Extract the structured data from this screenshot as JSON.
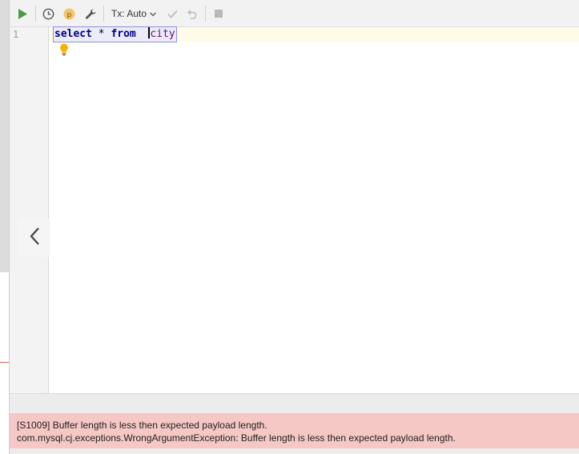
{
  "toolbar": {
    "run_icon": "play-icon",
    "history_icon": "clock-icon",
    "params_icon": "parameter-p-icon",
    "params_label": "p",
    "settings_icon": "wrench-icon",
    "tx_label": "Tx: Auto",
    "tx_dropdown_icon": "chevron-down-icon",
    "commit_icon": "check-icon",
    "rollback_icon": "undo-icon",
    "stop_icon": "stop-icon"
  },
  "editor": {
    "line_numbers": [
      "1"
    ],
    "code": {
      "kw1": "select",
      "mid": " * ",
      "kw2": "from",
      "space": "  ",
      "ident": "city"
    },
    "intention_icon": "lightbulb-icon"
  },
  "navigation": {
    "back_icon": "chevron-left-icon"
  },
  "error": {
    "line1": "[S1009] Buffer length is less then expected payload length.",
    "line2": "com.mysql.cj.exceptions.WrongArgumentException: Buffer length is less then expected payload length."
  },
  "colors": {
    "run_green": "#4a9c4a",
    "param_badge": "#f1c66a",
    "error_bg": "#f5c7c5",
    "keyword": "#000080",
    "identifier": "#660e7a",
    "current_line": "#fefbe8",
    "bulb": "#f5b400"
  }
}
